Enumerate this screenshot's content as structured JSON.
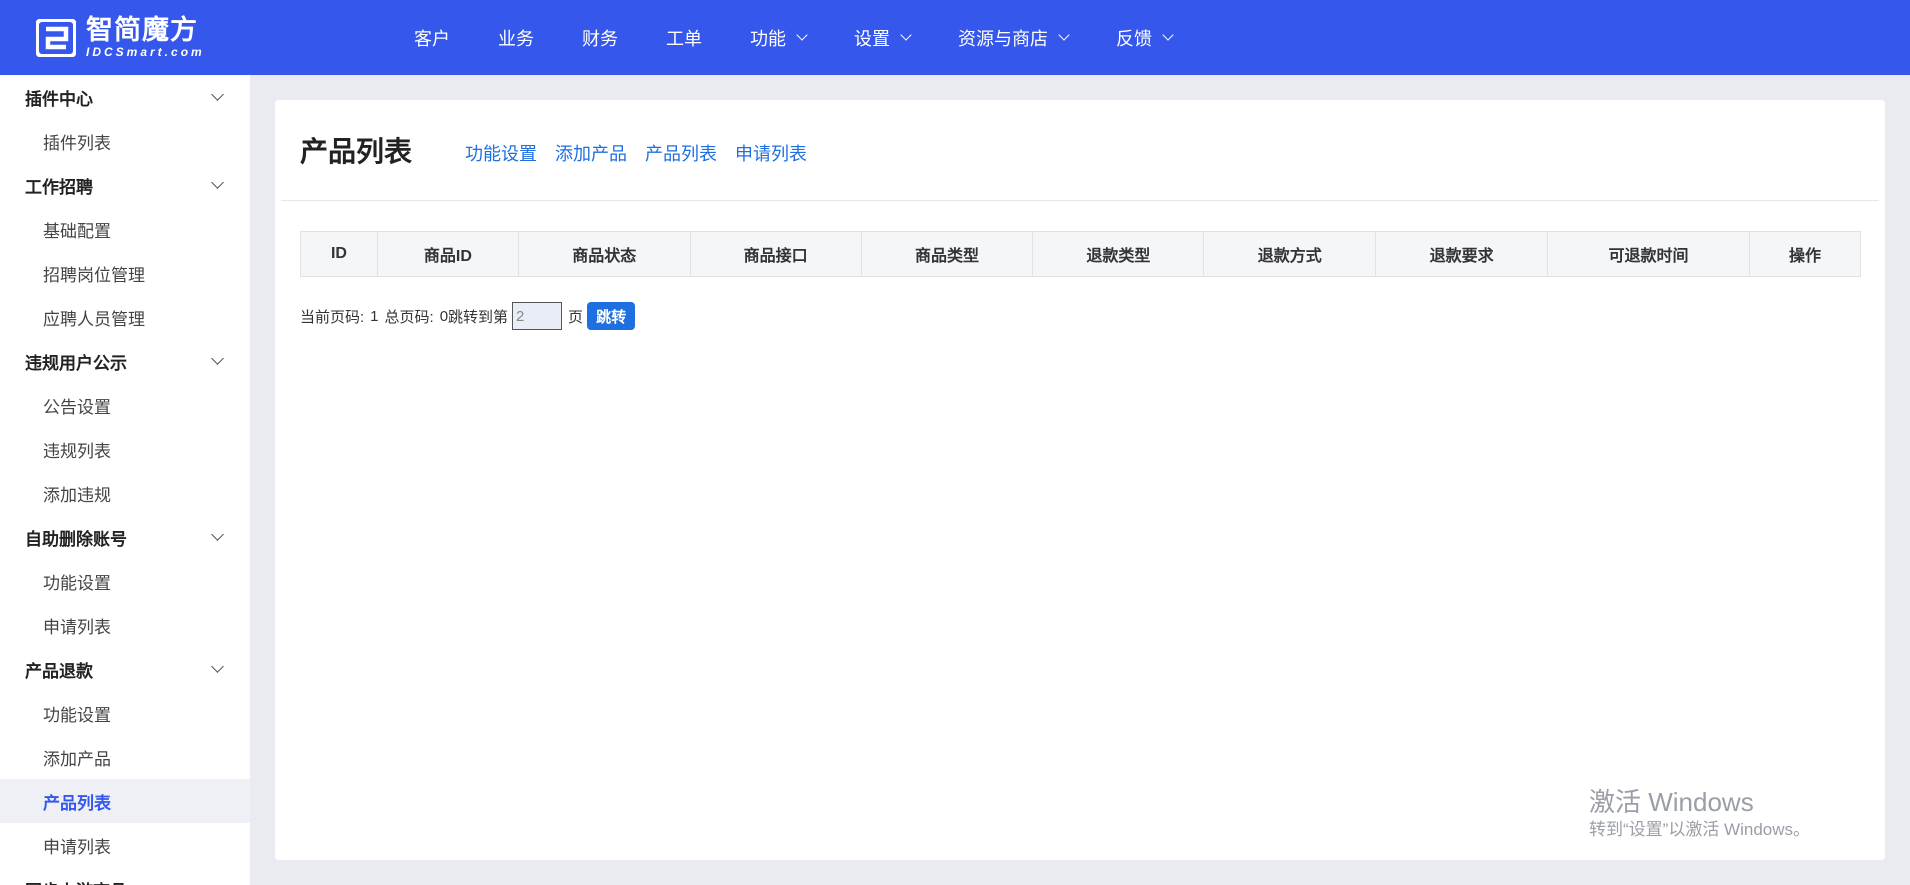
{
  "header": {
    "logo_text": "智简魔方",
    "logo_sub": "IDCSmart.com",
    "nav": [
      {
        "label": "客户",
        "dropdown": false
      },
      {
        "label": "业务",
        "dropdown": false
      },
      {
        "label": "财务",
        "dropdown": false
      },
      {
        "label": "工单",
        "dropdown": false
      },
      {
        "label": "功能",
        "dropdown": true
      },
      {
        "label": "设置",
        "dropdown": true
      },
      {
        "label": "资源与商店",
        "dropdown": true
      },
      {
        "label": "反馈",
        "dropdown": true
      }
    ]
  },
  "sidebar": {
    "groups": [
      {
        "title": "插件中心",
        "items": [
          "插件列表"
        ]
      },
      {
        "title": "工作招聘",
        "items": [
          "基础配置",
          "招聘岗位管理",
          "应聘人员管理"
        ]
      },
      {
        "title": "违规用户公示",
        "items": [
          "公告设置",
          "违规列表",
          "添加违规"
        ]
      },
      {
        "title": "自助删除账号",
        "items": [
          "功能设置",
          "申请列表"
        ]
      },
      {
        "title": "产品退款",
        "items": [
          "功能设置",
          "添加产品",
          "产品列表",
          "申请列表"
        ]
      },
      {
        "title": "同步上游商品",
        "items": []
      }
    ],
    "active_item": "产品列表"
  },
  "main": {
    "title": "产品列表",
    "links": [
      "功能设置",
      "添加产品",
      "产品列表",
      "申请列表"
    ],
    "table": {
      "columns": [
        "ID",
        "商品ID",
        "商品状态",
        "商品接口",
        "商品类型",
        "退款类型",
        "退款方式",
        "退款要求",
        "可退款时间",
        "操作"
      ],
      "rows": []
    },
    "pager": {
      "current_label": "当前页码:",
      "current_value": "1",
      "total_label": "总页码:",
      "total_value": "0",
      "jump_prefix": "跳转到第",
      "jump_value": "2",
      "jump_suffix": "页",
      "jump_button": "跳转"
    }
  },
  "watermark": {
    "line1": "激活 Windows",
    "line2": "转到“设置”以激活 Windows。"
  },
  "colors": {
    "topbar": "#3557eb",
    "link": "#1e6fe0",
    "active_item_bg": "#eef0f6"
  }
}
